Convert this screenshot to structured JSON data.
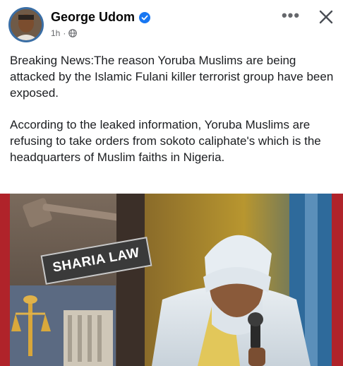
{
  "post": {
    "author": "George Udom",
    "timestamp": "1h",
    "separator": "·",
    "paragraphs": [
      "Breaking News:The reason Yoruba Muslims are being attacked by the Islamic Fulani killer terrorist group have been exposed.",
      "According to the leaked information, Yoruba Muslims are refusing to take orders from sokoto caliphate's which is the headquarters of Muslim faiths in Nigeria."
    ],
    "image_sign_text": "SHARIA LAW"
  },
  "icons": {
    "verified": "verified-badge-icon",
    "audience": "globe-icon",
    "more": "more-options-icon",
    "close": "close-icon"
  },
  "colors": {
    "verified": "#1877f2",
    "meta": "#65676b",
    "text": "#1c1e21"
  }
}
